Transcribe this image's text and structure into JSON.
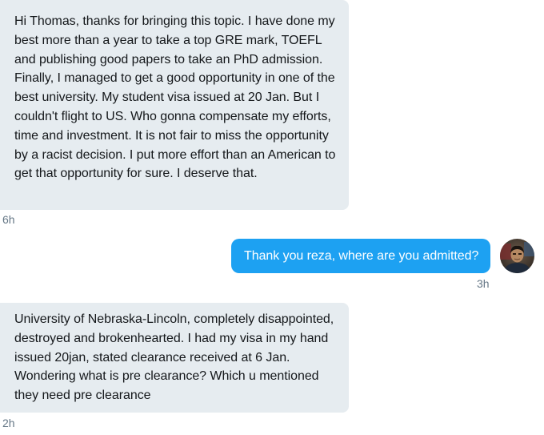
{
  "conversation": {
    "messages": [
      {
        "sender": "other",
        "text": "Hi Thomas, thanks for bringing this topic. I have done my best more than a year to take a top GRE mark, TOEFL and publishing good papers to take an PhD admission. Finally, I managed to get a good opportunity in one of the best university. My student visa issued at 20 Jan. But I couldn't flight to US. Who gonna compensate my efforts, time and investment. It is not fair to miss the opportunity by a racist decision. I put more effort than an American to get that opportunity for sure. I deserve that.",
        "time": "6h"
      },
      {
        "sender": "me",
        "text": "Thank you reza, where are you admitted?",
        "time": "3h"
      },
      {
        "sender": "other",
        "text": "University of Nebraska-Lincoln, completely disappointed, destroyed and brokenhearted. I had my visa in my hand issued 20jan, stated clearance received at 6 Jan. Wondering what is pre clearance? Which u mentioned they need pre clearance",
        "time": "2h"
      }
    ]
  },
  "colors": {
    "received_bubble": "#e6ecf0",
    "sent_bubble": "#1da1f2",
    "timestamp": "#657786",
    "text_dark": "#14171a"
  },
  "icons": {
    "user_avatar": "avatar"
  }
}
